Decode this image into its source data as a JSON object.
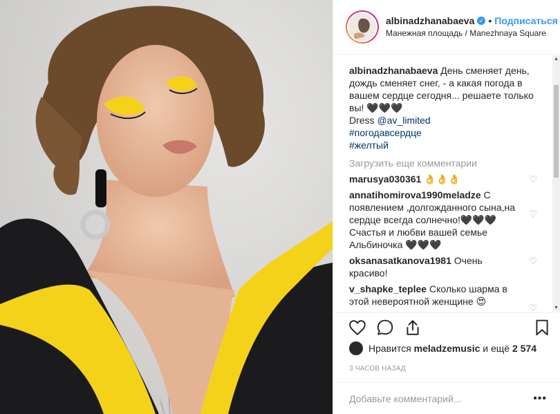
{
  "header": {
    "username": "albinadzhanabaeva",
    "separator": "•",
    "follow_label": "Подписаться",
    "location": "Манежная площадь / Manezhnaya Square"
  },
  "caption": {
    "username": "albinadzhanabaeva",
    "text": "День сменяет день, дождь сменяет снег, - а какая погода в вашем сердце сегодня... решаете только вы! 🖤🖤🖤",
    "dress_prefix": "Dress ",
    "mention": "@av_limited",
    "hashtag1": "#погодавсердце",
    "hashtag2": "#желтый"
  },
  "load_more_label": "Загрузить еще комментарии",
  "comments": [
    {
      "user": "marusya030361",
      "text": "👌👌👌"
    },
    {
      "user": "annatihomirova1990meladze",
      "text": "С появлением ,долгожданного сына,на сердце всегда солнечно!🖤🖤🖤 Счастья и любви вашей семье Альбиночка 🖤🖤🖤"
    },
    {
      "user": "oksanasatkanova1981",
      "text": "Очень красиво!"
    },
    {
      "user": "v_shapke_teplee",
      "text": "Сколько шарма в этой невероятной женщине 😍"
    }
  ],
  "likes": {
    "prefix": "Нравится",
    "user": "meladzemusic",
    "middle": "и ещё",
    "count": "2 574"
  },
  "timestamp": "3 ЧАСОВ НАЗАД",
  "add_comment_placeholder": "Добавьте комментарий...",
  "more_options": "•••",
  "icons": {
    "like": "heart-icon",
    "comment": "comment-icon",
    "share": "share-icon",
    "save": "bookmark-icon",
    "comment_like": "heart-small-icon"
  },
  "colors": {
    "link": "#3897f0",
    "hashtag": "#003569",
    "muted": "#999999",
    "photo_yellow": "#f5d21a"
  }
}
